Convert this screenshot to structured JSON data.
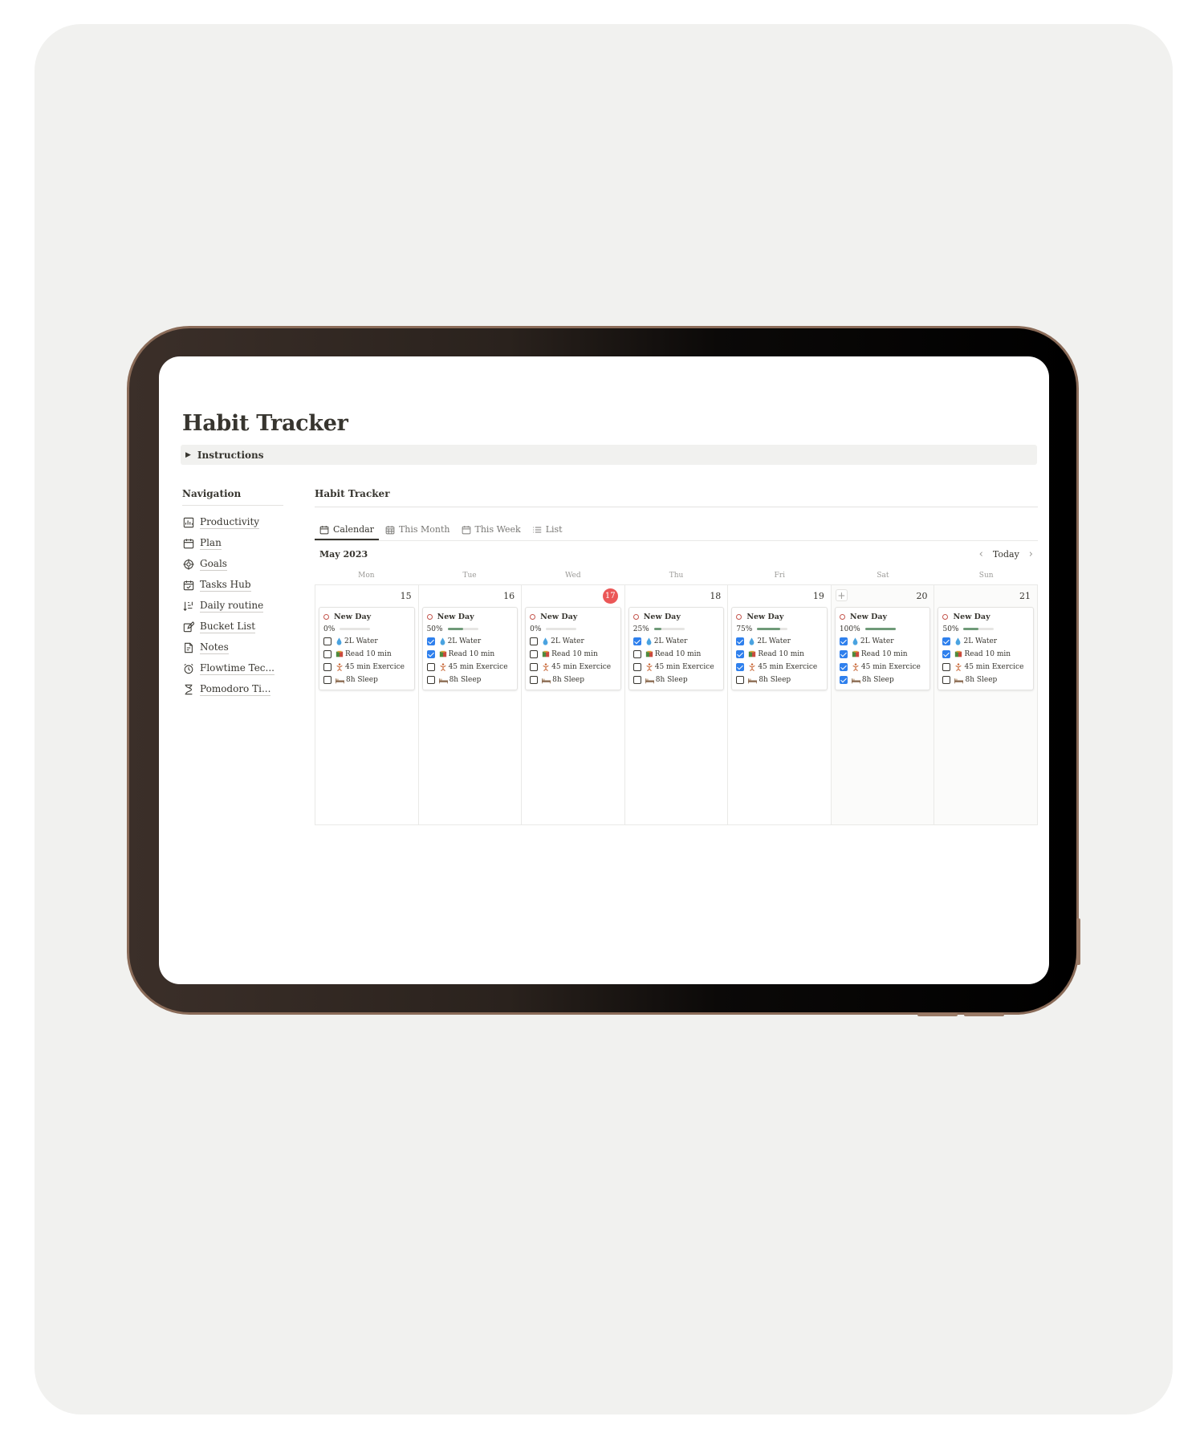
{
  "page": {
    "title": "Habit Tracker",
    "instructions_label": "Instructions"
  },
  "navigation": {
    "heading": "Navigation",
    "items": [
      {
        "label": "Productivity",
        "icon": "chart-icon"
      },
      {
        "label": "Plan",
        "icon": "calendar-icon"
      },
      {
        "label": "Goals",
        "icon": "target-icon"
      },
      {
        "label": "Tasks Hub",
        "icon": "calendar-check-icon"
      },
      {
        "label": "Daily routine",
        "icon": "list-sort-icon"
      },
      {
        "label": "Bucket List",
        "icon": "edit-icon"
      },
      {
        "label": "Notes",
        "icon": "document-icon"
      },
      {
        "label": "Flowtime Tec...",
        "icon": "alarm-icon"
      },
      {
        "label": "Pomodoro Ti...",
        "icon": "hourglass-icon"
      }
    ]
  },
  "database": {
    "title": "Habit Tracker",
    "tabs": [
      {
        "label": "Calendar",
        "icon": "calendar-icon",
        "active": true
      },
      {
        "label": "This Month",
        "icon": "grid-calendar-icon",
        "active": false
      },
      {
        "label": "This Week",
        "icon": "calendar-icon",
        "active": false
      },
      {
        "label": "List",
        "icon": "list-icon",
        "active": false
      }
    ],
    "month_label": "May 2023",
    "today_label": "Today",
    "weekdays": [
      "Mon",
      "Tue",
      "Wed",
      "Thu",
      "Fri",
      "Sat",
      "Sun"
    ],
    "habit_labels": [
      "2L Water",
      "Read 10 min",
      "45 min Exercice",
      "8h Sleep"
    ],
    "habit_icons": [
      "droplet-icon",
      "book-icon",
      "exercise-icon",
      "bed-icon"
    ],
    "days": [
      {
        "num": "15",
        "today": false,
        "weekend": false,
        "entry": "New Day",
        "pct_label": "0%",
        "progress": 0,
        "checks": [
          false,
          false,
          false,
          false
        ]
      },
      {
        "num": "16",
        "today": false,
        "weekend": false,
        "entry": "New Day",
        "pct_label": "50%",
        "progress": 0.5,
        "checks": [
          true,
          true,
          false,
          false
        ]
      },
      {
        "num": "17",
        "today": true,
        "weekend": false,
        "entry": "New Day",
        "pct_label": "0%",
        "progress": 0,
        "checks": [
          false,
          false,
          false,
          false
        ]
      },
      {
        "num": "18",
        "today": false,
        "weekend": false,
        "entry": "New Day",
        "pct_label": "25%",
        "progress": 0.25,
        "checks": [
          true,
          false,
          false,
          false
        ]
      },
      {
        "num": "19",
        "today": false,
        "weekend": false,
        "entry": "New Day",
        "pct_label": "75%",
        "progress": 0.75,
        "checks": [
          true,
          true,
          true,
          false
        ]
      },
      {
        "num": "20",
        "today": false,
        "weekend": true,
        "add_button": true,
        "entry": "New Day",
        "pct_label": "100%",
        "progress": 1,
        "checks": [
          true,
          true,
          true,
          true
        ]
      },
      {
        "num": "21",
        "today": false,
        "weekend": true,
        "entry": "New Day",
        "pct_label": "50%",
        "progress": 0.5,
        "checks": [
          true,
          true,
          false,
          false
        ]
      }
    ]
  },
  "colors": {
    "progress_fill": "#6f9a78",
    "checkbox_checked": "#2f80ed",
    "today_badge": "#eb5757",
    "status_dot": "#c4554d"
  }
}
